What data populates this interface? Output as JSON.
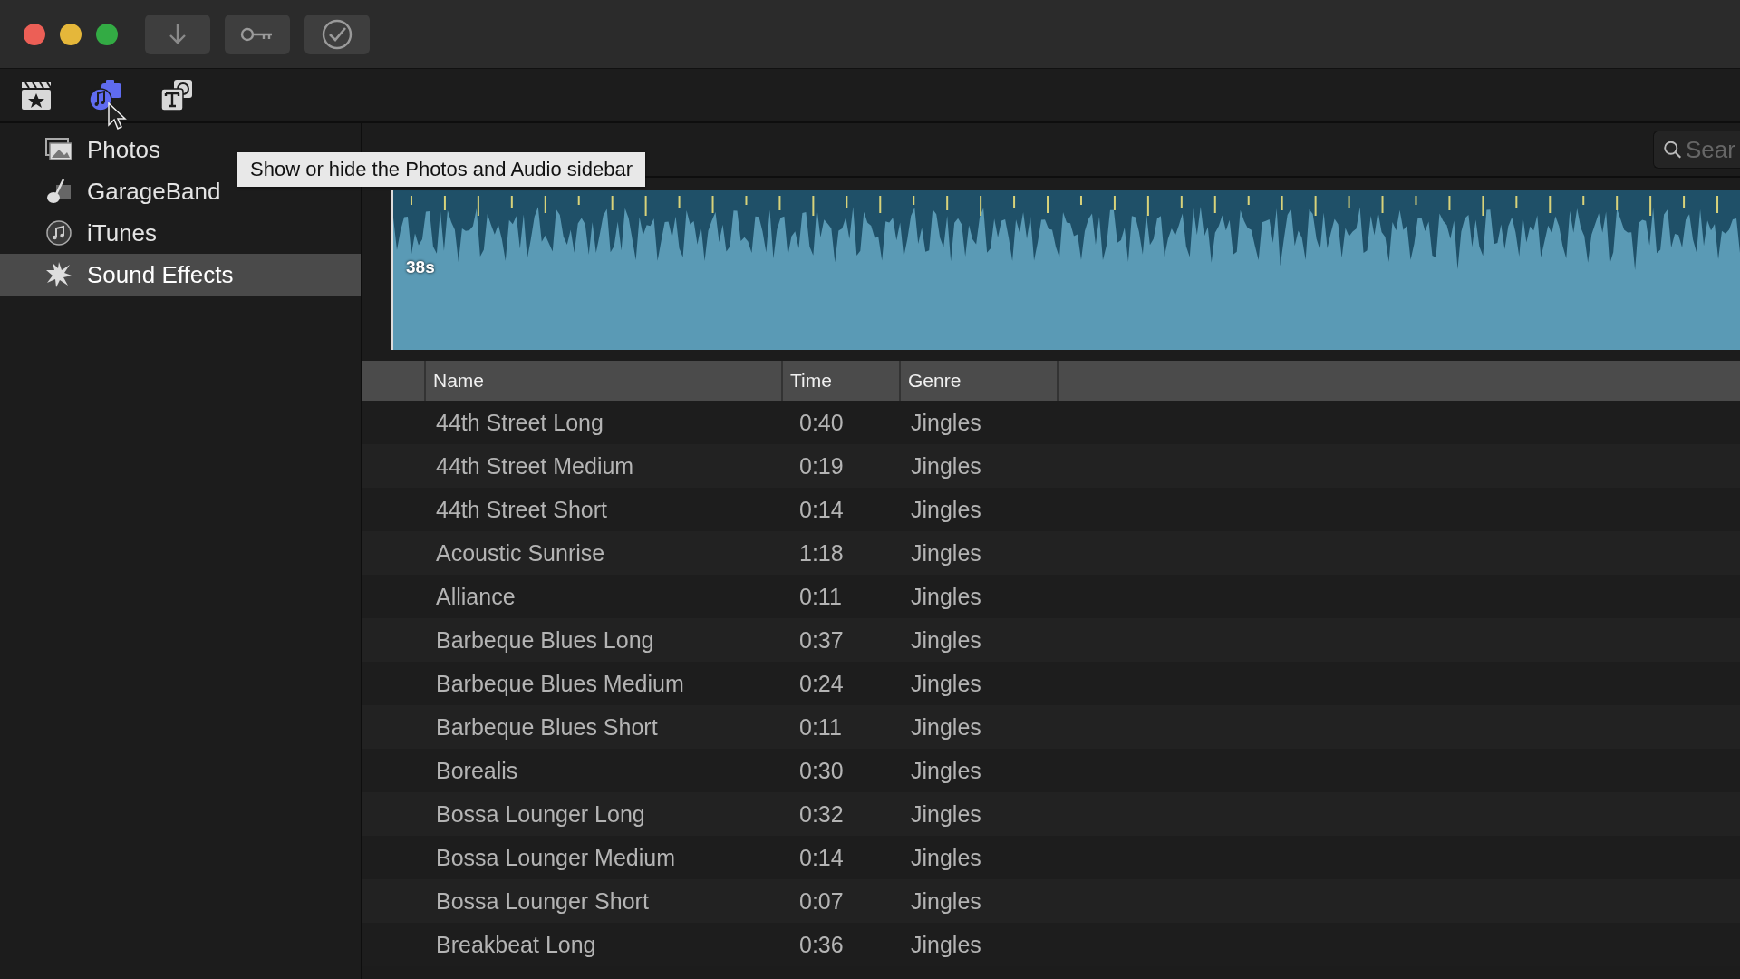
{
  "toolbar": {
    "buttons": [
      {
        "kind": "import"
      },
      {
        "kind": "key"
      },
      {
        "kind": "check"
      }
    ]
  },
  "view_tabs": [
    {
      "kind": "movie",
      "selected": false
    },
    {
      "kind": "media",
      "selected": true
    },
    {
      "kind": "titles",
      "selected": false
    }
  ],
  "tooltip": "Show or hide the Photos and Audio sidebar",
  "sidebar": {
    "items": [
      {
        "label": "Photos",
        "kind": "photos",
        "selected": false
      },
      {
        "label": "GarageBand",
        "kind": "guitar",
        "selected": false
      },
      {
        "label": "iTunes",
        "kind": "music",
        "selected": false
      },
      {
        "label": "Sound Effects",
        "kind": "burst",
        "selected": true
      }
    ]
  },
  "search": {
    "placeholder": "Sear"
  },
  "preview": {
    "duration": "38s"
  },
  "table": {
    "columns": [
      "Name",
      "Time",
      "Genre"
    ],
    "rows": [
      {
        "name": "44th Street Long",
        "time": "0:40",
        "genre": "Jingles"
      },
      {
        "name": "44th Street Medium",
        "time": "0:19",
        "genre": "Jingles"
      },
      {
        "name": "44th Street Short",
        "time": "0:14",
        "genre": "Jingles"
      },
      {
        "name": "Acoustic Sunrise",
        "time": "1:18",
        "genre": "Jingles"
      },
      {
        "name": "Alliance",
        "time": "0:11",
        "genre": "Jingles"
      },
      {
        "name": "Barbeque Blues Long",
        "time": "0:37",
        "genre": "Jingles"
      },
      {
        "name": "Barbeque Blues Medium",
        "time": "0:24",
        "genre": "Jingles"
      },
      {
        "name": "Barbeque Blues Short",
        "time": "0:11",
        "genre": "Jingles"
      },
      {
        "name": "Borealis",
        "time": "0:30",
        "genre": "Jingles"
      },
      {
        "name": "Bossa Lounger Long",
        "time": "0:32",
        "genre": "Jingles"
      },
      {
        "name": "Bossa Lounger Medium",
        "time": "0:14",
        "genre": "Jingles"
      },
      {
        "name": "Bossa Lounger Short",
        "time": "0:07",
        "genre": "Jingles"
      },
      {
        "name": "Breakbeat Long",
        "time": "0:36",
        "genre": "Jingles"
      }
    ]
  }
}
